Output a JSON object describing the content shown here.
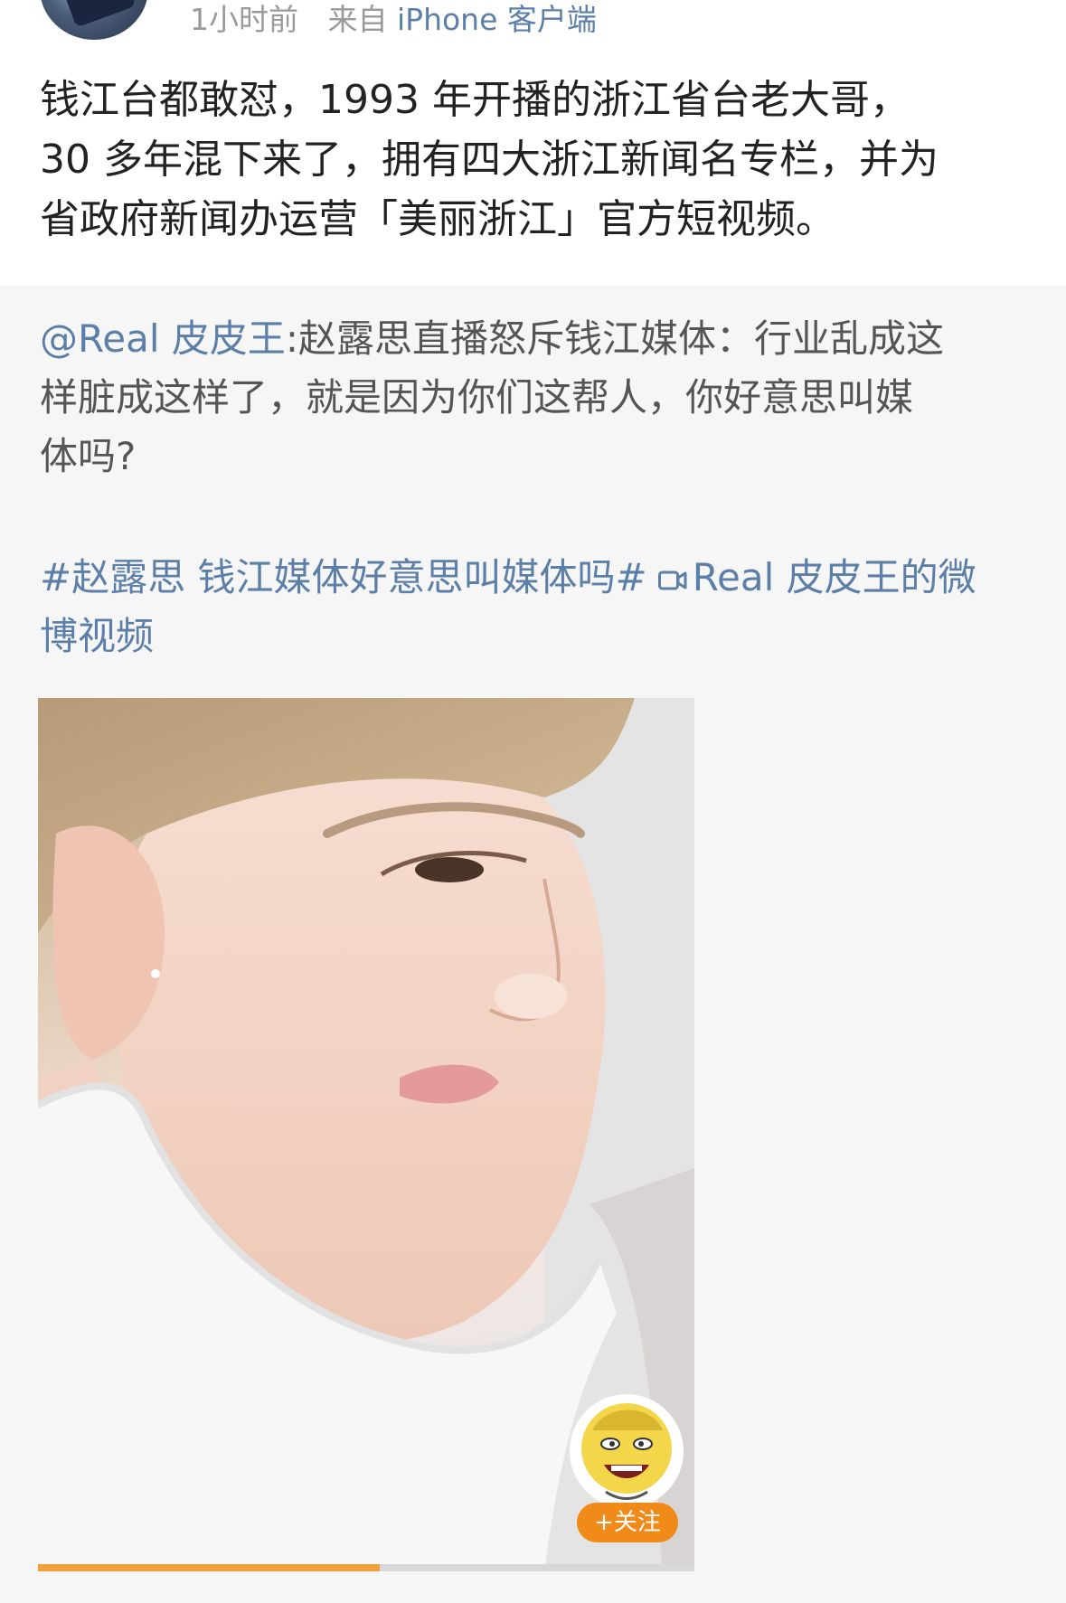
{
  "post": {
    "time": "1小时前",
    "source_prefix": "来自",
    "device": "iPhone 客户端",
    "text_lines": [
      "钱江台都敢怼，1993 年开播的浙江省台老大哥，",
      "30 多年混下来了，拥有四大浙江新闻名专栏，并为",
      "省政府新闻办运营「美丽浙江」官方短视频。"
    ]
  },
  "repost": {
    "mention": "@Real 皮皮王",
    "text_line1_rest": ":赵露思直播怒斥钱江媒体：行业乱成这",
    "text_line2": "样脏成这样了，就是因为你们这帮人，你好意思叫媒",
    "text_line3": "体吗?",
    "hashtag": "#赵露思 钱江媒体好意思叫媒体吗#",
    "video_link_line1": "Real 皮皮王的微",
    "video_link_line2": "博视频",
    "video_link_icon": "video-camera-icon"
  },
  "video": {
    "progress": 0.52,
    "progress_color": "#f0a13a",
    "follow_label": "+关注",
    "follow_color": "#f08a18"
  },
  "colors": {
    "link": "#5b7fa8",
    "text": "#222222",
    "repost_bg": "#f6f6f6",
    "meta": "#9a9a9a"
  }
}
